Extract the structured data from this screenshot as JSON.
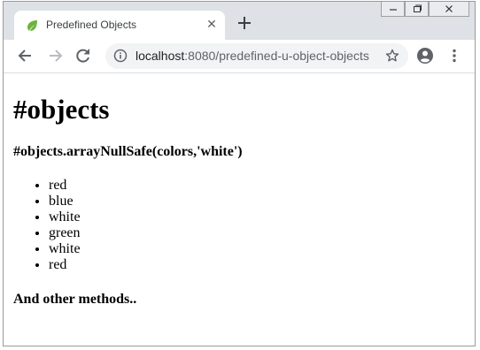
{
  "browser": {
    "tab": {
      "title": "Predefined Objects",
      "favicon": "spring-leaf-icon",
      "close_glyph": "✕"
    },
    "address": {
      "host": "localhost",
      "path": ":8080/predefined-u-object-objects"
    },
    "icons": {
      "back": "back-arrow-icon",
      "forward": "forward-arrow-icon",
      "reload": "reload-icon",
      "info": "info-icon",
      "bookmark": "star-icon",
      "account": "account-icon",
      "menu": "kebab-menu-icon"
    },
    "colors": {
      "frame": "#dee1e6",
      "omnibox": "#f1f3f4",
      "favicon_green": "#6db33f"
    }
  },
  "page": {
    "heading": "#objects",
    "subheading": "#objects.arrayNullSafe(colors,'white')",
    "items": [
      "red",
      "blue",
      "white",
      "green",
      "white",
      "red"
    ],
    "footer": "And other methods.."
  }
}
